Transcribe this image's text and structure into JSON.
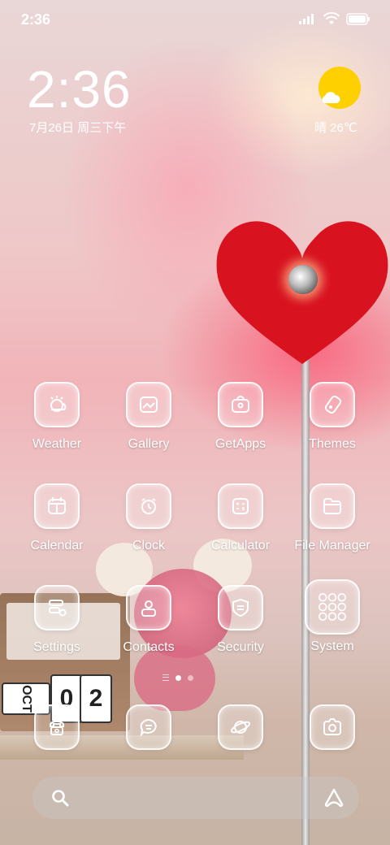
{
  "status_bar": {
    "time": "2:36",
    "icons": [
      "signal-icon",
      "wifi-icon",
      "battery-icon"
    ]
  },
  "clock_widget": {
    "time": "2:36",
    "date": "7月26日 周三下午"
  },
  "weather_widget": {
    "icon": "partly-sunny-icon",
    "text": "晴 26℃"
  },
  "apps": [
    {
      "label": "Weather",
      "icon": "weather-icon"
    },
    {
      "label": "Gallery",
      "icon": "gallery-icon"
    },
    {
      "label": "GetApps",
      "icon": "getapps-icon"
    },
    {
      "label": "Themes",
      "icon": "themes-icon"
    },
    {
      "label": "Calendar",
      "icon": "calendar-icon"
    },
    {
      "label": "Clock",
      "icon": "clock-icon"
    },
    {
      "label": "Calculator",
      "icon": "calculator-icon"
    },
    {
      "label": "File Manager",
      "icon": "file-manager-icon"
    },
    {
      "label": "Settings",
      "icon": "settings-icon"
    },
    {
      "label": "Contacts",
      "icon": "contacts-icon"
    },
    {
      "label": "Security",
      "icon": "security-icon"
    },
    {
      "label": "System",
      "icon": "system-folder-icon"
    }
  ],
  "dock": [
    {
      "icon": "phone-icon"
    },
    {
      "icon": "messages-icon"
    },
    {
      "icon": "browser-icon"
    },
    {
      "icon": "camera-icon"
    }
  ],
  "wallpaper_text": {
    "calendar_month": "OCT",
    "calendar_day_1": "0",
    "calendar_day_2": "2"
  },
  "page_indicator": {
    "pages": 2,
    "active": 1
  },
  "search_bar": {
    "left_icon": "search-icon",
    "right_icon": "assistant-icon"
  }
}
